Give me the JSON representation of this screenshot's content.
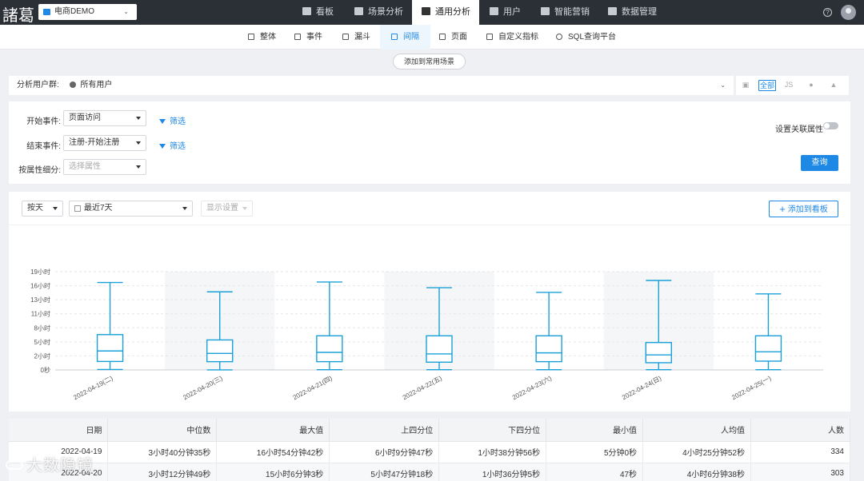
{
  "app": {
    "logo": "諸葛",
    "project": "电商DEMO",
    "nav": [
      {
        "label": "看板",
        "icon": "dashboard-icon"
      },
      {
        "label": "场景分析",
        "icon": "scenario-icon"
      },
      {
        "label": "通用分析",
        "icon": "bar-chart-icon"
      },
      {
        "label": "用户",
        "icon": "user-icon"
      },
      {
        "label": "智能营销",
        "icon": "marketing-icon"
      },
      {
        "label": "数据管理",
        "icon": "database-icon"
      }
    ],
    "help_glyph": "?"
  },
  "subnav": [
    {
      "label": "整体",
      "icon": "phone-icon"
    },
    {
      "label": "事件",
      "icon": "line-chart-icon"
    },
    {
      "label": "漏斗",
      "icon": "funnel-icon"
    },
    {
      "label": "间隔",
      "icon": "interval-icon"
    },
    {
      "label": "页面",
      "icon": "page-icon"
    },
    {
      "label": "自定义指标",
      "icon": "custom-metric-icon"
    },
    {
      "label": "SQL查询平台",
      "icon": "search-icon"
    }
  ],
  "add_scene_label": "添加到常用场景",
  "user_group": {
    "label": "分析用户群:",
    "value": "所有用户"
  },
  "platforms": {
    "all": "全部"
  },
  "config": {
    "start_label": "开始事件:",
    "start_value": "页面访问",
    "end_label": "结束事件:",
    "end_value": "注册-开始注册",
    "split_label": "按属性细分:",
    "split_placeholder": "选择属性",
    "filter_label": "筛选",
    "assoc_label": "设置关联属性",
    "query_label": "查询"
  },
  "chart_toolbar": {
    "granularity": "按天",
    "date_range": "最近7天",
    "display": "显示设置",
    "add_board": "添加到看板"
  },
  "chart_data": {
    "type": "boxplot",
    "y_ticks": [
      "0秒",
      "2小时",
      "5小时",
      "8小时",
      "11小时",
      "13小时",
      "16小时",
      "19小时"
    ],
    "ylim": [
      0,
      19
    ],
    "grid": true,
    "categories": [
      "2022-04-19(二)",
      "2022-04-20(三)",
      "2022-04-21(四)",
      "2022-04-22(五)",
      "2022-04-23(六)",
      "2022-04-24(日)",
      "2022-04-25(一)"
    ],
    "boxes": [
      {
        "min": 0.09,
        "q1": 1.64,
        "median": 3.67,
        "q3": 6.83,
        "max": 16.9
      },
      {
        "min": 0.01,
        "q1": 1.6,
        "median": 3.2,
        "q3": 5.8,
        "max": 15.1
      },
      {
        "min": 0.05,
        "q1": 1.6,
        "median": 3.4,
        "q3": 6.6,
        "max": 17.0
      },
      {
        "min": 0.05,
        "q1": 1.5,
        "median": 3.1,
        "q3": 6.6,
        "max": 15.9
      },
      {
        "min": 0.05,
        "q1": 1.6,
        "median": 3.3,
        "q3": 6.6,
        "max": 15.0
      },
      {
        "min": 0.05,
        "q1": 1.4,
        "median": 2.9,
        "q3": 5.3,
        "max": 17.3
      },
      {
        "min": 0.05,
        "q1": 1.7,
        "median": 3.5,
        "q3": 6.6,
        "max": 14.7
      }
    ]
  },
  "table": {
    "headers": [
      "日期",
      "中位数",
      "最大值",
      "上四分位",
      "下四分位",
      "最小值",
      "人均值",
      "人数"
    ],
    "rows": [
      [
        "2022-04-19",
        "3小时40分钟35秒",
        "16小时54分钟42秒",
        "6小时9分钟47秒",
        "1小时38分钟56秒",
        "5分钟0秒",
        "4小时25分钟52秒",
        "334"
      ],
      [
        "2022-04-20",
        "3小时12分钟49秒",
        "15小时6分钟3秒",
        "5小时47分钟18秒",
        "1小时36分钟5秒",
        "47秒",
        "4小时6分钟38秒",
        "303"
      ]
    ]
  },
  "watermark": "大数隐镜"
}
